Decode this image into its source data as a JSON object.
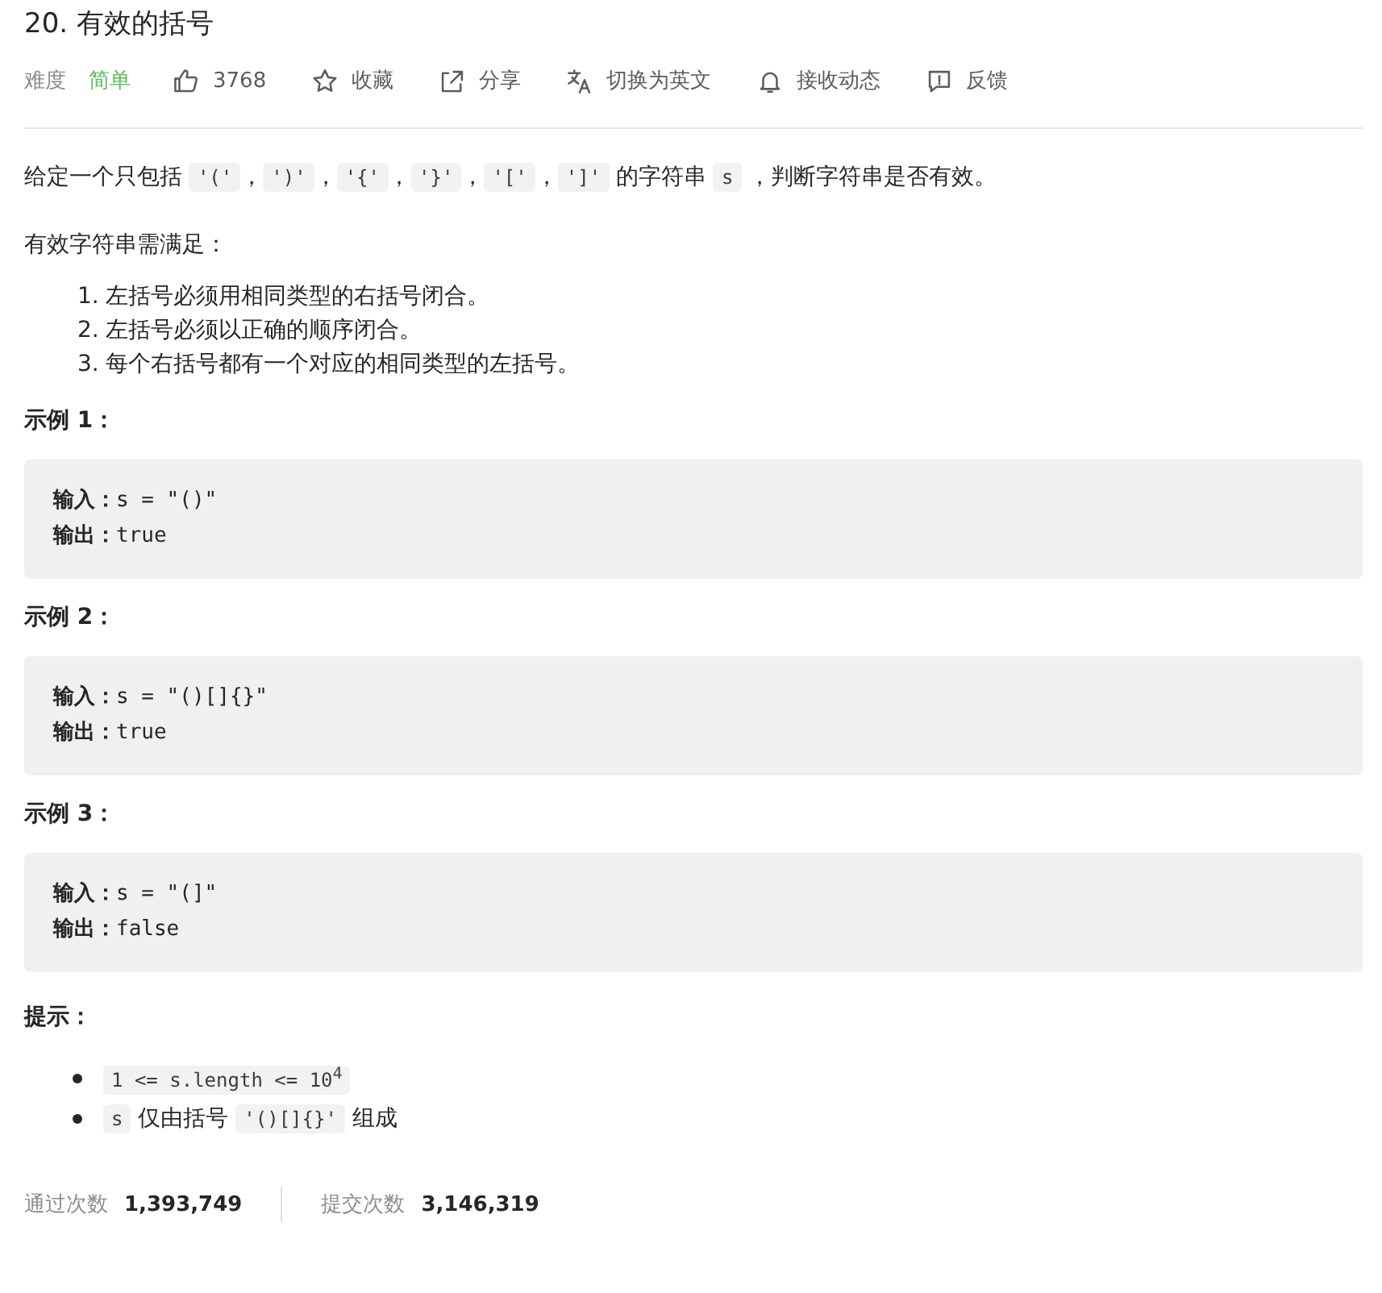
{
  "title": "20. 有效的括号",
  "meta": {
    "difficulty_label": "难度",
    "difficulty": "简单",
    "actions": [
      {
        "kind": "like",
        "label": "3768"
      },
      {
        "kind": "star",
        "label": "收藏"
      },
      {
        "kind": "share",
        "label": "分享"
      },
      {
        "kind": "translate",
        "label": "切换为英文"
      },
      {
        "kind": "bell",
        "label": "接收动态"
      },
      {
        "kind": "feedback",
        "label": "反馈"
      }
    ]
  },
  "intro": [
    {
      "kind": "text",
      "text": "给定一个只包括 "
    },
    {
      "kind": "code",
      "text": "'('"
    },
    {
      "kind": "text",
      "text": "，"
    },
    {
      "kind": "code",
      "text": "')'"
    },
    {
      "kind": "text",
      "text": "，"
    },
    {
      "kind": "code",
      "text": "'{'"
    },
    {
      "kind": "text",
      "text": "，"
    },
    {
      "kind": "code",
      "text": "'}'"
    },
    {
      "kind": "text",
      "text": "，"
    },
    {
      "kind": "code",
      "text": "'['"
    },
    {
      "kind": "text",
      "text": "，"
    },
    {
      "kind": "code",
      "text": "']'"
    },
    {
      "kind": "text",
      "text": " 的字符串 "
    },
    {
      "kind": "code",
      "text": "s"
    },
    {
      "kind": "text",
      "text": " ，判断字符串是否有效。"
    }
  ],
  "rules_heading": "有效字符串需满足：",
  "rules": [
    {
      "number": "1.",
      "text": "左括号必须用相同类型的右括号闭合。"
    },
    {
      "number": "2.",
      "text": "左括号必须以正确的顺序闭合。"
    },
    {
      "number": "3.",
      "text": "每个右括号都有一个对应的相同类型的左括号。"
    }
  ],
  "examples": [
    {
      "heading": "示例 1：",
      "lines": [
        "**输入：**s = \"()\"",
        "**输出：**true"
      ]
    },
    {
      "heading": "示例 2：",
      "lines": [
        "**输入：**s = \"()[]{}\"",
        "**输出：**true"
      ]
    },
    {
      "heading": "示例 3：",
      "lines": [
        "**输入：**s = \"(]\"",
        "**输出：**false"
      ]
    }
  ],
  "hints_heading": "提示：",
  "hints": [
    [
      {
        "kind": "code",
        "text": "1 <= s.length <= 10$^{4}$"
      }
    ],
    [
      {
        "kind": "code",
        "text": "s"
      },
      {
        "kind": "text",
        "text": " 仅由括号 "
      },
      {
        "kind": "code",
        "text": "'()[]{}'"
      },
      {
        "kind": "text",
        "text": " 组成"
      }
    ]
  ],
  "stats": [
    {
      "label": "通过次数",
      "value": "1,393,749"
    },
    {
      "label": "提交次数",
      "value": "3,146,319"
    }
  ]
}
